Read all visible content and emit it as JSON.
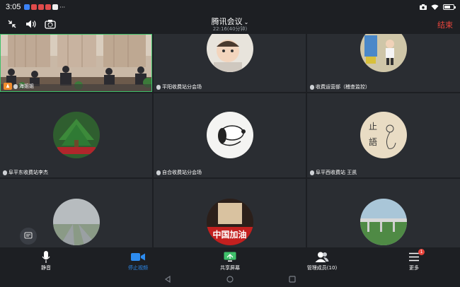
{
  "status_bar": {
    "time": "3:05",
    "more": "···"
  },
  "header": {
    "title": "腾讯会议",
    "title_chevron": "⌄",
    "duration": "22:16(40分钟)",
    "end_label": "结束"
  },
  "participants": [
    {
      "name": "海姐姐",
      "host_badge": "♟"
    },
    {
      "name": "平阳收费站分会场"
    },
    {
      "name": "收费运营部（稽查监控）"
    },
    {
      "name": "阜平东收费站李杰"
    },
    {
      "name": "自合收费站分会场"
    },
    {
      "name": "阜平西收费站 王凯"
    },
    {
      "name": ""
    },
    {
      "name": "",
      "avatar_text": "中国加油"
    },
    {
      "name": ""
    }
  ],
  "calligraphy": {
    "top": "止",
    "bottom": "語"
  },
  "toolbar": {
    "mute_label": "静音",
    "stop_video_label": "停止视频",
    "share_screen_label": "共享屏幕",
    "manage_members_label": "管理成员(10)",
    "more_label": "更多",
    "more_badge": "1"
  },
  "colors": {
    "accent": "#2d8cf0",
    "end": "#e8453c",
    "background": "#1d1f23",
    "tile": "#2a2d32"
  }
}
